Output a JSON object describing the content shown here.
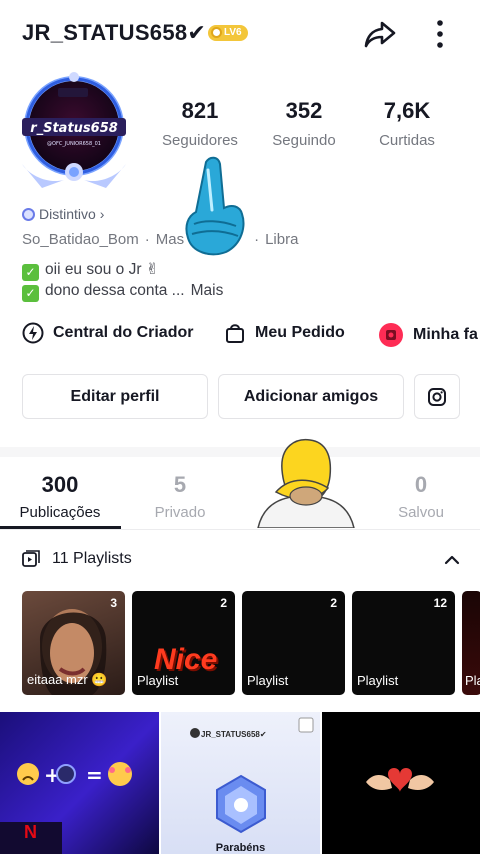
{
  "header": {
    "username": "JR_STATUS658✔",
    "level_badge": "LV6",
    "share_icon": "share-arrow-icon",
    "more_icon": "more-vertical-icon"
  },
  "avatar": {
    "banner_text": "r_Status658",
    "sub_text": "@OFC_JUNIOR658_01"
  },
  "stats": [
    {
      "value": "821",
      "label": "Seguidores"
    },
    {
      "value": "352",
      "label": "Seguindo"
    },
    {
      "value": "7,6K",
      "label": "Curtidas"
    }
  ],
  "profile": {
    "distintivo": "Distintivo",
    "tags": [
      "So_Batidao_Bom",
      "Mas",
      "Libra"
    ],
    "bio_line1": "oii eu sou o Jr ✌",
    "bio_line2": "dono dessa conta ...",
    "bio_more": "Mais"
  },
  "quicklinks": [
    {
      "label": "Central do Criador",
      "icon": "creator-bolt-icon"
    },
    {
      "label": "Meu Pedido",
      "icon": "shopping-bag-icon"
    },
    {
      "label": "Minha fa",
      "icon": "fan-badge-icon"
    }
  ],
  "actions": {
    "edit": "Editar perfil",
    "add_friends": "Adicionar amigos",
    "instagram_icon": "instagram-icon"
  },
  "tabs": [
    {
      "value": "300",
      "label": "Publicações",
      "active": true
    },
    {
      "value": "5",
      "label": "Privado",
      "active": false
    },
    {
      "value": "0",
      "label": "Salvou",
      "active": false
    }
  ],
  "playlists": {
    "header": "11 Playlists",
    "items": [
      {
        "count": "3",
        "title": "eitaaa mzr 😬"
      },
      {
        "count": "2",
        "title": "Playlist",
        "overlay": "Nice"
      },
      {
        "count": "2",
        "title": "Playlist"
      },
      {
        "count": "12",
        "title": "Playlist"
      },
      {
        "count": "",
        "title": "Pla"
      }
    ]
  },
  "grid": {
    "video2_user": "JR_STATUS658✔",
    "video2_caption": "Parabéns",
    "video1_brand": "N"
  },
  "colors": {
    "accent_red": "#fe2c55",
    "badge_gold": "#f3c63a",
    "avatar_ring": "#4a7bf0"
  }
}
